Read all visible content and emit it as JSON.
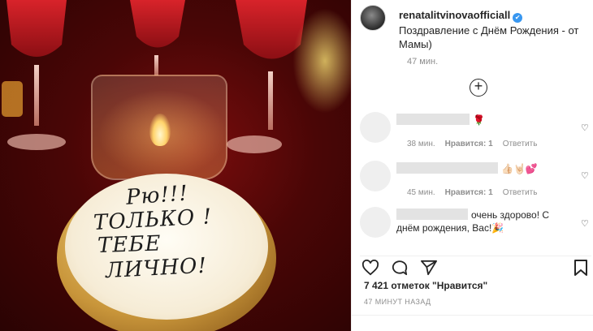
{
  "post": {
    "author": "renatalitvinova​officiall",
    "verified_glyph": "✔",
    "caption": "Поздравление с Днём Рождения - от Мамы)",
    "time": "47 мин.",
    "load_more_glyph": "+"
  },
  "photo": {
    "lid_text": [
      "Рю!!!",
      "ТОЛЬКО !",
      "ТЕБЕ",
      "ЛИЧНО!"
    ]
  },
  "comments": [
    {
      "text": "🌹",
      "time": "38 мин.",
      "likes": "Нравится: 1",
      "reply": "Ответить"
    },
    {
      "text": "👍🏻🤘🏻💕",
      "time": "45 мин.",
      "likes": "Нравится: 1",
      "reply": "Ответить"
    },
    {
      "text": "очень здорово! С днём рождения, Вас!🎉",
      "time": "",
      "likes": "",
      "reply": ""
    }
  ],
  "actions": {
    "like_icon": "heart-outline",
    "comment_icon": "speech-bubble",
    "share_icon": "paper-plane",
    "save_icon": "bookmark"
  },
  "likes_text": "7 421 отметок \"Нравится\"",
  "timestamp": "47 МИНУТ НАЗАД",
  "colors": {
    "verified": "#3897f0",
    "text": "#262626",
    "muted": "#8e8e8e"
  }
}
